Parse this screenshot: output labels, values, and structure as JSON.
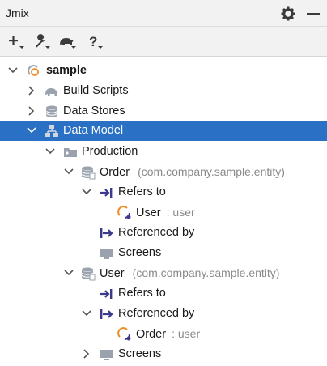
{
  "window": {
    "title": "Jmix"
  },
  "titlebar_icons": [
    "gear-icon",
    "minimize-icon"
  ],
  "toolbar": {
    "items": [
      {
        "name": "add-button",
        "symbol": "+"
      },
      {
        "name": "tools-button",
        "symbol": "wrench"
      },
      {
        "name": "gradle-button",
        "symbol": "elephant"
      },
      {
        "name": "help-button",
        "symbol": "?"
      }
    ]
  },
  "colors": {
    "selection": "#2a70c4",
    "toolbar_bg": "#f2f2f2",
    "arrow_icon": "#3d3a8c",
    "entity_icon": "#9aa3ad",
    "user_orange": "#f08a24"
  },
  "tree": {
    "project": "sample",
    "build_scripts": "Build Scripts",
    "data_stores": "Data Stores",
    "data_model": "Data Model",
    "production": "Production",
    "order": {
      "name": "Order",
      "package": "(com.company.sample.entity)"
    },
    "order_refers_to": "Refers to",
    "order_refers_user": {
      "name": "User",
      "type": ": user"
    },
    "order_referenced_by": "Referenced by",
    "order_screens": "Screens",
    "user": {
      "name": "User",
      "package": "(com.company.sample.entity)"
    },
    "user_refers_to": "Refers to",
    "user_referenced_by": "Referenced by",
    "user_referenced_order": {
      "name": "Order",
      "type": ": user"
    },
    "user_screens": "Screens"
  }
}
